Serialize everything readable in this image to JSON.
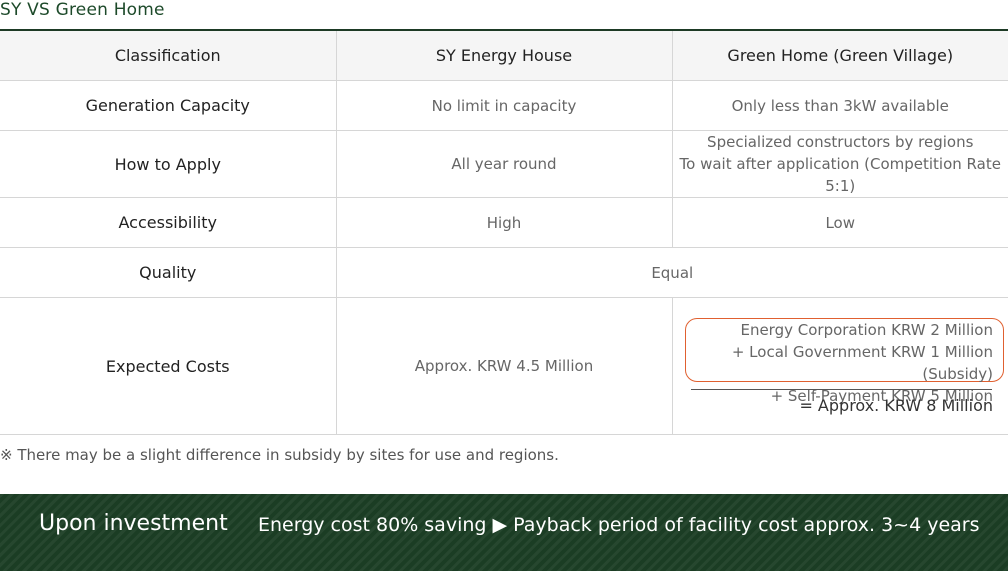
{
  "title": "SY  VS  Green Home",
  "table": {
    "headers": [
      "Classification",
      "SY Energy House",
      "Green Home (Green Village)"
    ],
    "rows": [
      {
        "label": "Generation Capacity",
        "sy": "No limit in capacity",
        "green": "Only less than 3kW available"
      },
      {
        "label": "How to Apply",
        "sy": "All year round",
        "green_lines": [
          "Specialized constructors by regions",
          "To wait after application (Competition Rate 5:1)"
        ]
      },
      {
        "label": "Accessibility",
        "sy": "High",
        "green": "Low"
      },
      {
        "label": "Quality",
        "both": "Equal"
      },
      {
        "label": "Expected Costs",
        "sy": "Approx. KRW 4.5 Million",
        "green_lines": [
          "Energy Corporation KRW 2 Million",
          "+ Local Government KRW 1 Million (Subsidy)",
          "+ Self-Payment KRW 5 Million"
        ],
        "green_total": "= Approx. KRW 8 Million"
      }
    ]
  },
  "note": "※ There may be a slight difference in subsidy by sites for use and regions.",
  "banner": {
    "heading": "Upon investment",
    "text": "Energy cost 80% saving ▶ Payback period of facility cost approx.  3~4 years"
  },
  "colors": {
    "accent_green": "#1b3d24",
    "highlight_orange": "#e06030"
  }
}
